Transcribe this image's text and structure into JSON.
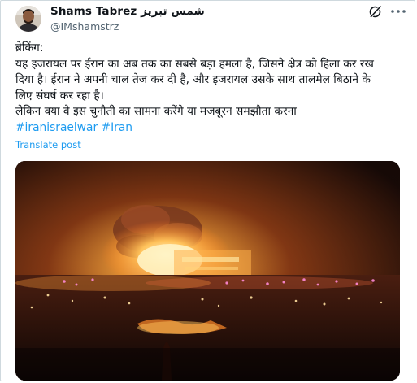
{
  "author": {
    "display_name": "Shams Tabrez شمس تبریز",
    "handle": "@IMshamstrz"
  },
  "post": {
    "lines": [
      "ब्रेकिंग:",
      "यह इजरायल पर ईरान का अब तक का सबसे बड़ा हमला है, जिसने क्षेत्र को हिला कर रख",
      "दिया है। ईरान ने अपनी चाल तेज कर दी है, और इजरायल उसके साथ तालमेल बिठाने के",
      "लिए संघर्ष कर रहा है।",
      "लेकिन क्या वे इस चुनौती का सामना करेंगे या मजबूरन समझौता करना"
    ],
    "hashtags": [
      "#iranisraelwar",
      "#Iran"
    ],
    "translate_label": "Translate post"
  },
  "icons": {
    "grok": "grok-icon",
    "more": "more-icon",
    "avatar": "avatar"
  },
  "colors": {
    "link": "#1d9bf0",
    "text": "#0f1419",
    "secondary": "#536471",
    "border": "#cfd9de"
  }
}
